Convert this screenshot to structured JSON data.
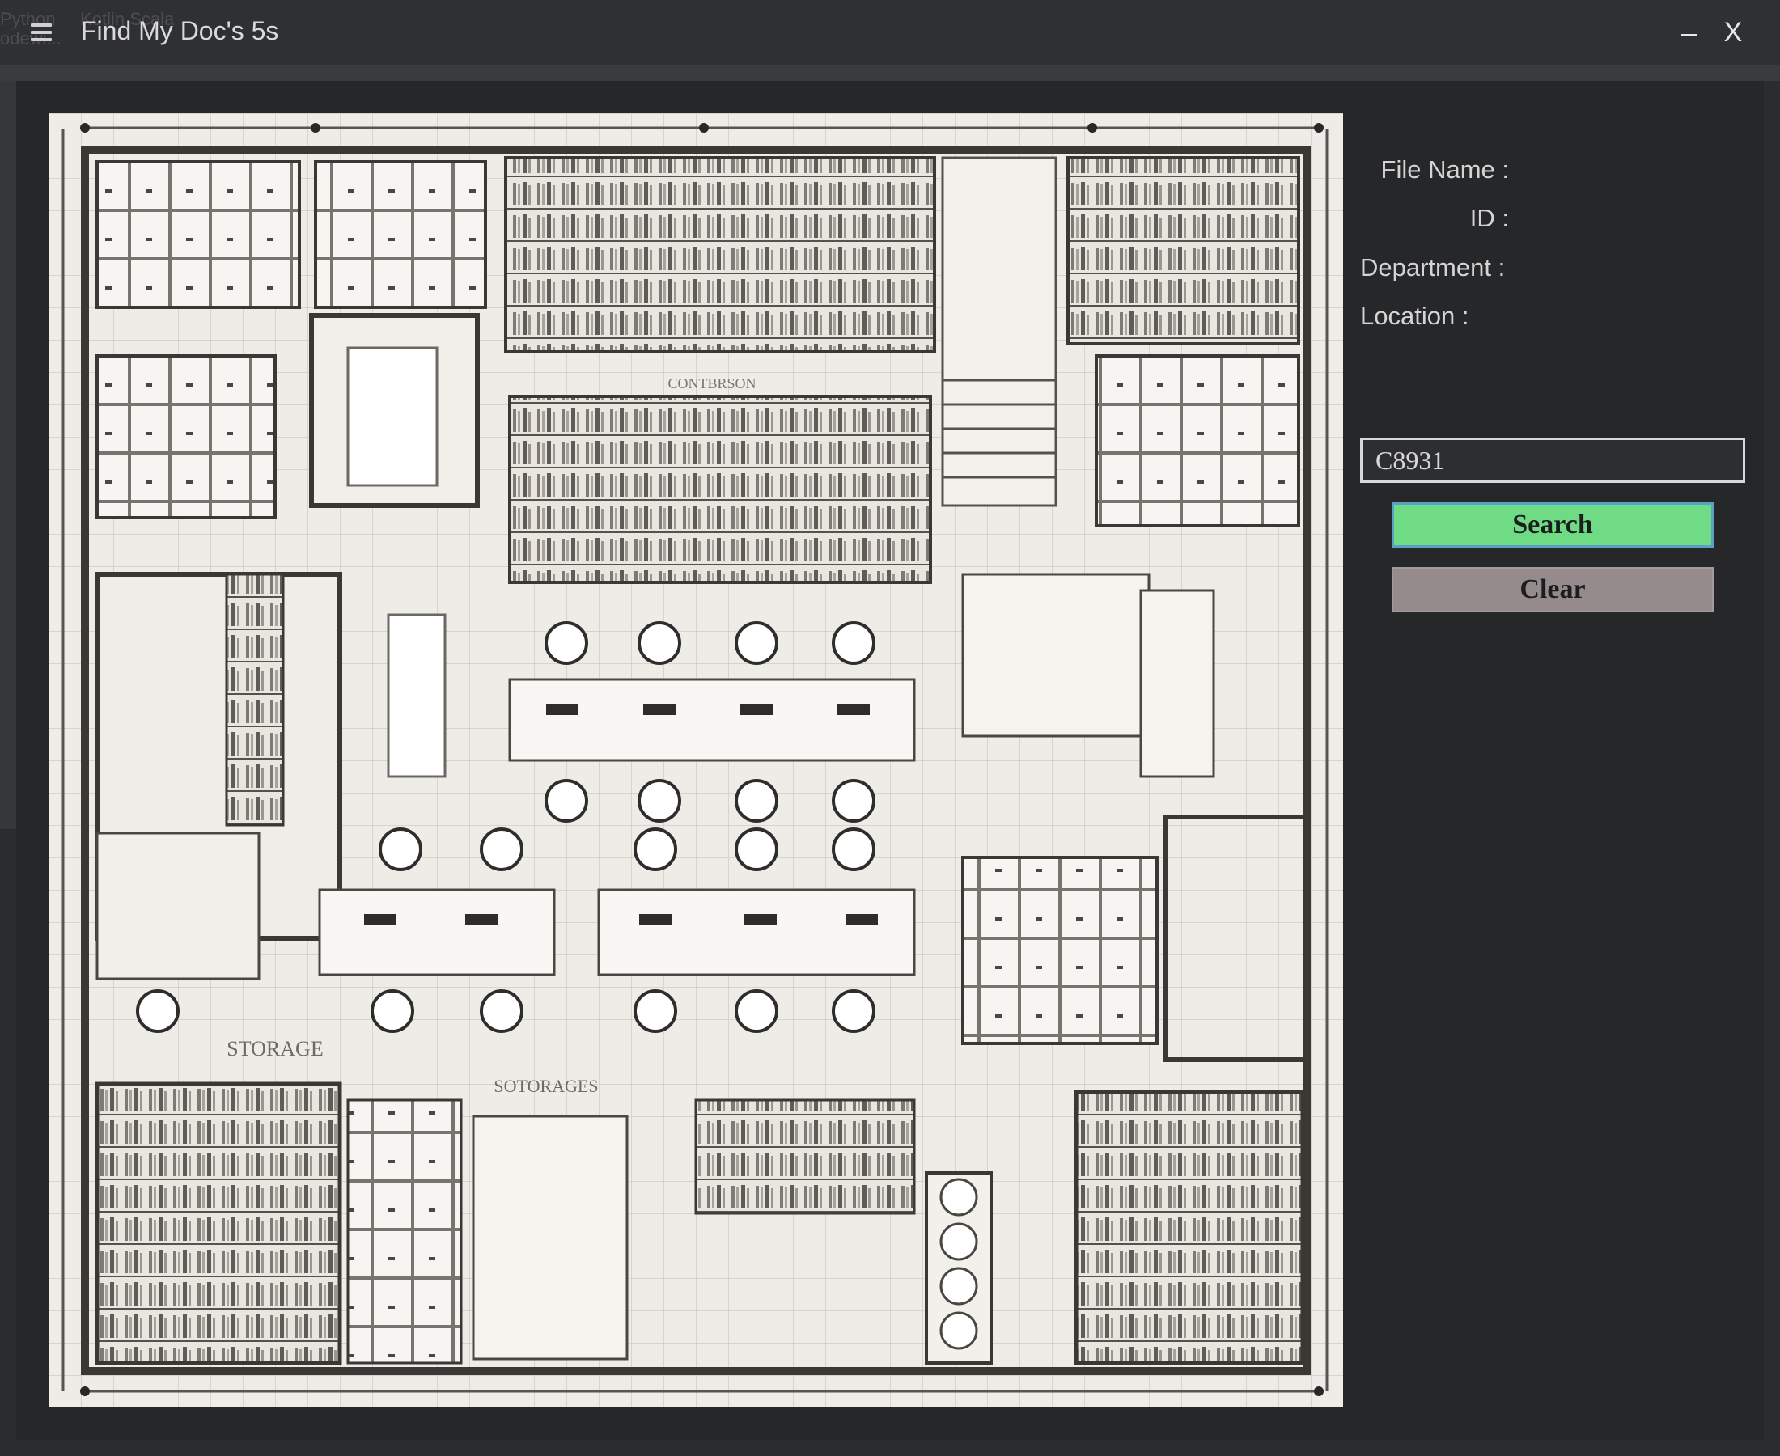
{
  "window": {
    "title": "Find My Doc's 5s",
    "menu_icon": "hamburger-menu-icon",
    "minimize_icon": "minimize-icon",
    "close_label": "X",
    "background_ghost_text": "Python     Kotlin Scala\nodewi..."
  },
  "floorplan": {
    "description_icon": "office-floor-plan-image",
    "labels": [
      "STORAGE",
      "SOTORAGES",
      "CONTBRSON"
    ]
  },
  "details": {
    "file_name_label": "File Name :",
    "file_name_value": "",
    "id_label": "ID :",
    "id_value": "",
    "department_label": "Department :",
    "department_value": "",
    "location_label": "Location :",
    "location_value": ""
  },
  "search": {
    "input_value": "C8931",
    "search_label": "Search",
    "clear_label": "Clear"
  },
  "colors": {
    "background": "#2b2c2e",
    "search_button": "#6fdc85",
    "clear_button": "#958b8d"
  }
}
